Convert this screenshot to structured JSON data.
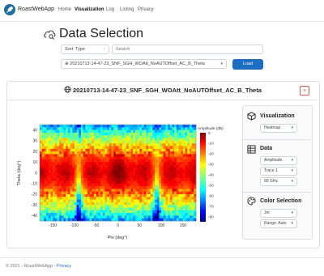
{
  "navbar": {
    "brand": "RoastWebApp",
    "links": [
      "Home",
      "Visualization",
      "Log",
      "Listing",
      "Privacy"
    ],
    "active": "Visualization"
  },
  "header": {
    "title": "Data Selection",
    "sort_select": "Sort: Type",
    "search_placeholder": "Search",
    "file_select": "20210713-14-47-23_SNF_SGH_WOAtt_NoAUTOffset_AC_B_Theta",
    "load_label": "Load"
  },
  "card": {
    "title": "20210713-14-47-23_SNF_SGH_WOAtt_NoAUTOffset_AC_B_Theta",
    "close": "×"
  },
  "panel": {
    "visualization": {
      "title": "Visualization",
      "type_select": "Heatmap"
    },
    "data": {
      "title": "Data",
      "quantity_select": "Amplitude",
      "trace_select": "Trace 1",
      "frequency_select": "90 GHz"
    },
    "color": {
      "title": "Color Selection",
      "map_select": "Jet",
      "range_select": "Range: Auto"
    }
  },
  "footer": {
    "text": "© 2021 - RoastWebApp - ",
    "link": "Privacy"
  },
  "chart_data": {
    "type": "heatmap",
    "xlabel": "Phi (deg°)",
    "ylabel": "Theta (deg°)",
    "colorbar_label": "Amplitude (dB)",
    "x_ticks": [
      -150,
      -100,
      -50,
      0,
      50,
      100,
      150
    ],
    "y_ticks": [
      40,
      30,
      20,
      10,
      0,
      -10,
      -20,
      -30,
      -40
    ],
    "colorbar_ticks": [
      0,
      -10,
      -20,
      -30,
      -40,
      -50,
      -60,
      -70,
      -80
    ],
    "xlim": [
      -180,
      180
    ],
    "ylim": [
      -45,
      45
    ],
    "zlim": [
      -85,
      0
    ],
    "colormap": "jet",
    "nulls_phi": [
      -90,
      90
    ],
    "peak_theta": [
      -20,
      20
    ]
  }
}
